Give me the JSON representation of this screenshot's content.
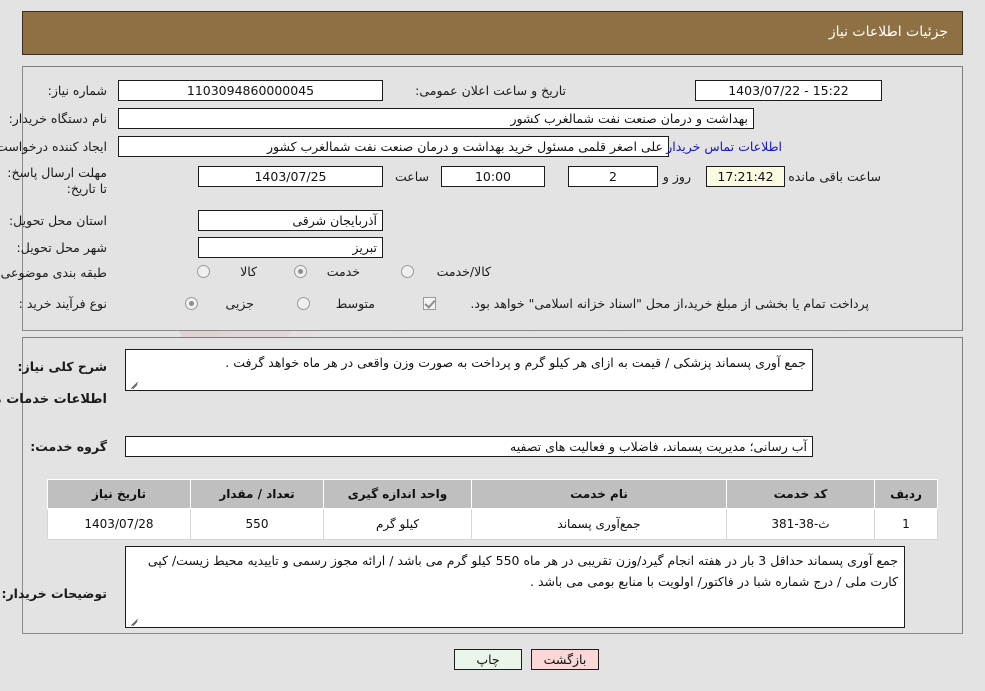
{
  "header": {
    "title": "جزئیات اطلاعات نیاز"
  },
  "top_form": {
    "need_number_label": "شماره نیاز:",
    "need_number_value": "1103094860000045",
    "public_announce_label": "تاریخ و ساعت اعلان عمومی:",
    "public_announce_value": "15:22 - 1403/07/22",
    "buyer_org_label": "نام دستگاه خریدار:",
    "buyer_org_value": "بهداشت و درمان صنعت نفت شمالغرب کشور",
    "creator_label": "ایجاد کننده درخواست:",
    "creator_value": "علی اصغر قلمی مسئول خرید بهداشت و درمان صنعت نفت شمالغرب کشور",
    "contact_link": "اطلاعات تماس خریدار",
    "deadline_label": "مهلت ارسال پاسخ: تا تاریخ:",
    "deadline_date": "1403/07/25",
    "hour_label": "ساعت",
    "deadline_time": "10:00",
    "days_value": "2",
    "days_label": "روز و",
    "countdown_value": "17:21:42",
    "remaining_label": "ساعت باقی مانده",
    "province_label": "استان محل تحویل:",
    "province_value": "آذربایجان شرقی",
    "city_label": "شهر محل تحویل:",
    "city_value": "تبریز",
    "category_label": "طبقه بندی موضوعی:",
    "category_options": [
      {
        "label": "کالا",
        "selected": false
      },
      {
        "label": "خدمت",
        "selected": true
      },
      {
        "label": "کالا/خدمت",
        "selected": false
      }
    ],
    "process_label": "نوع فرآیند خرید :",
    "process_options": [
      {
        "label": "جزیی",
        "selected": true
      },
      {
        "label": "متوسط",
        "selected": false
      }
    ],
    "treasury_checkbox_label": "پرداخت تمام یا بخشی از مبلغ خرید،از محل \"اسناد خزانه اسلامی\" خواهد بود.",
    "treasury_checked": true
  },
  "main": {
    "summary_label": "شرح کلی نیاز:",
    "summary_value": "جمع آوری پسماند پزشکی / قیمت به ازای هر کیلو گرم و پرداخت به صورت وزن واقعی در هر ماه خواهد گرفت .",
    "services_heading": "اطلاعات خدمات مورد نیاز",
    "service_group_label": "گروه خدمت:",
    "service_group_value": "آب رسانی؛ مدیریت پسماند، فاضلاب و فعالیت های تصفیه",
    "notes_label": "توضیحات خریدار:",
    "notes_value": "جمع آوری پسماند حداقل 3 بار در هفته انجام گیرد/وزن تقریبی در هر ماه 550 کیلو گرم می باشد / ارائه مجوز رسمی و تاییدیه محیط زیست/ کپی کارت ملی / درج شماره شبا در فاکتور/ اولویت با منابع بومی می باشد ."
  },
  "table": {
    "columns": [
      "ردیف",
      "کد خدمت",
      "نام خدمت",
      "واحد اندازه گیری",
      "تعداد / مقدار",
      "تاریخ نیاز"
    ],
    "rows": [
      {
        "row_no": "1",
        "service_code": "ث-38-381",
        "service_name": "جمع‌آوری پسماند",
        "unit": "کیلو گرم",
        "quantity": "550",
        "need_date": "1403/07/28"
      }
    ]
  },
  "footer": {
    "print_label": "چاپ",
    "back_label": "بازگشت"
  },
  "watermark": {
    "text": "AriaTender.net"
  },
  "colors": {
    "header_bar": "#8f7043",
    "page_bg": "#e3e3e3",
    "link": "#1414c8",
    "countdown_bg": "#fbfbe2",
    "table_header_bg": "#bfbfbf",
    "print_btn_bg": "#e9f6e9",
    "back_btn_bg": "#fbd8d8"
  }
}
